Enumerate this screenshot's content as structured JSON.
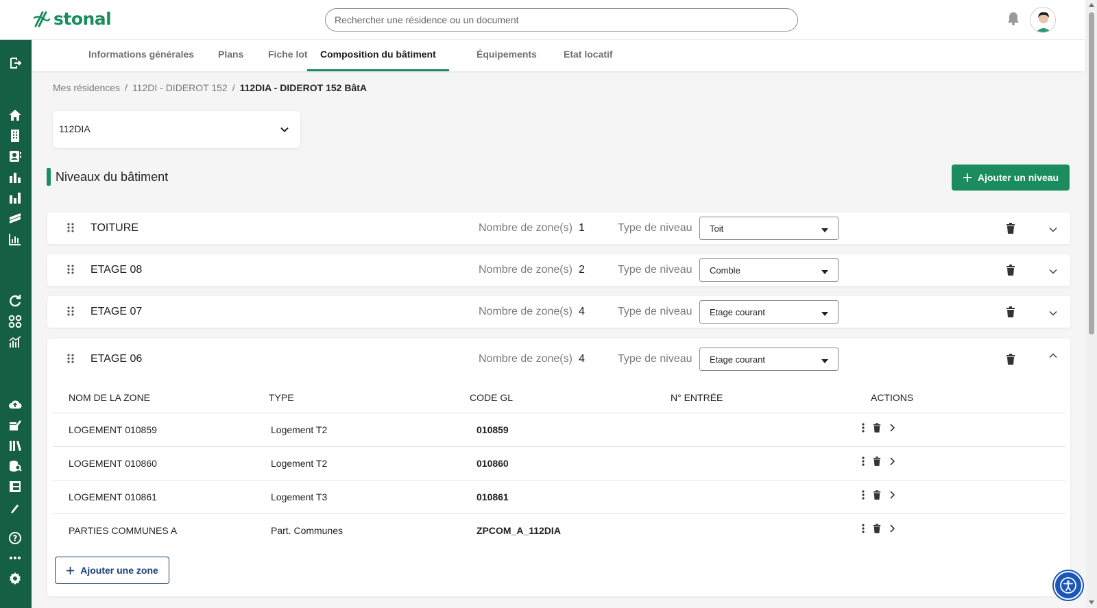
{
  "brand": {
    "name": "stonal",
    "color": "#1a8c5e",
    "sidebar_color": "#155f44"
  },
  "search": {
    "placeholder": "Rechercher une résidence ou un document"
  },
  "header_icons": [
    "bell-icon",
    "user-avatar"
  ],
  "sidebar": {
    "icons": [
      "logout-icon",
      "home-icon",
      "building-icon",
      "contact-card-icon",
      "bar-chart-icon",
      "bar-chart-alt-icon",
      "layers-icon",
      "line-chart-icon",
      "refresh-icon",
      "apps-grid-icon",
      "analytics-icon",
      "cloud-upload-icon",
      "edit-stack-icon",
      "library-icon",
      "database-search-icon",
      "panel-icon",
      "pen-icon",
      "help-icon",
      "more-icon",
      "settings-icon"
    ]
  },
  "tabs": [
    {
      "label": "Informations générales",
      "active": false
    },
    {
      "label": "Plans",
      "active": false
    },
    {
      "label": "Fiche lot",
      "active": false
    },
    {
      "label": "Composition du bâtiment",
      "active": true
    },
    {
      "label": "Équipements",
      "active": false
    },
    {
      "label": "Etat locatif",
      "active": false
    }
  ],
  "breadcrumb": {
    "items": [
      "Mes résidences",
      "112DI - DIDEROT 152",
      "112DIA - DIDEROT 152 BâtA"
    ],
    "separator": "/"
  },
  "building_select": {
    "value": "112DIA"
  },
  "section": {
    "title": "Niveaux du bâtiment",
    "add_button": "Ajouter un niveau"
  },
  "level_labels": {
    "zones": "Nombre de zone(s)",
    "type": "Type de niveau"
  },
  "levels": [
    {
      "name": "TOITURE",
      "zones": "1",
      "type": "Toit",
      "expanded": false
    },
    {
      "name": "ETAGE 08",
      "zones": "2",
      "type": "Comble",
      "expanded": false
    },
    {
      "name": "ETAGE 07",
      "zones": "4",
      "type": "Etage courant",
      "expanded": false
    },
    {
      "name": "ETAGE 06",
      "zones": "4",
      "type": "Etage courant",
      "expanded": true
    }
  ],
  "zone_table": {
    "headers": [
      "NOM DE LA ZONE",
      "TYPE",
      "CODE GL",
      "N° ENTRÉE",
      "ACTIONS"
    ],
    "rows": [
      {
        "name": "LOGEMENT 010859",
        "type": "Logement T2",
        "code": "010859",
        "entry": ""
      },
      {
        "name": "LOGEMENT 010860",
        "type": "Logement T2",
        "code": "010860",
        "entry": ""
      },
      {
        "name": "LOGEMENT 010861",
        "type": "Logement T3",
        "code": "010861",
        "entry": ""
      },
      {
        "name": "PARTIES COMMUNES A",
        "type": "Part. Communes",
        "code": "ZPCOM_A_112DIA",
        "entry": ""
      }
    ],
    "add_button": "Ajouter une zone"
  },
  "accessibility_button": "accessibility-icon"
}
